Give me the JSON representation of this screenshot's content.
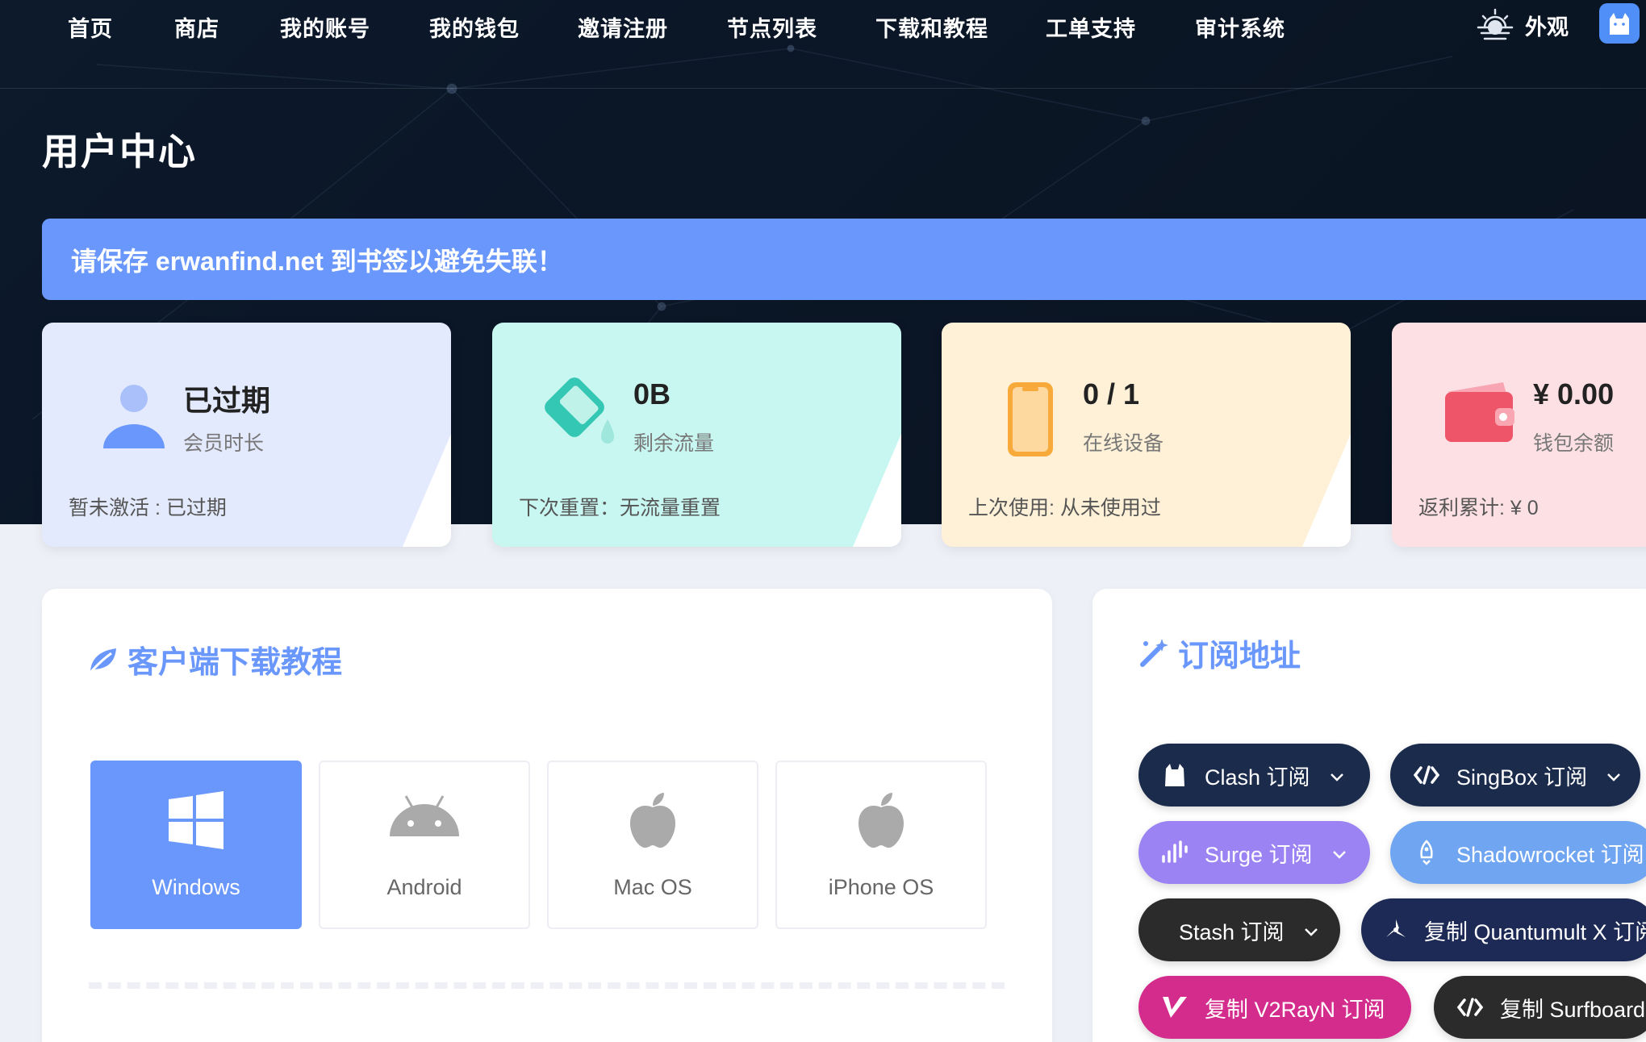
{
  "nav": {
    "items": [
      "首页",
      "商店",
      "我的账号",
      "我的钱包",
      "邀请注册",
      "节点列表",
      "下载和教程",
      "工单支持",
      "审计系统"
    ],
    "appearance_label": "外观"
  },
  "page_title": "用户中心",
  "alert_text": "请保存 erwanfind.net 到书签以避免失联！",
  "stats": [
    {
      "value": "已过期",
      "label": "会员时长",
      "foot": "暂未激活 : 已过期",
      "bg": "#e4eafd",
      "icon": "user-icon"
    },
    {
      "value": "0B",
      "label": "剩余流量",
      "foot": "下次重置：无流量重置",
      "bg": "#c8f6f0",
      "icon": "water-bucket-icon"
    },
    {
      "value": "0 / 1",
      "label": "在线设备",
      "foot": "上次使用: 从未使用过",
      "bg": "#fef1d7",
      "icon": "phone-icon"
    },
    {
      "value": "¥ 0.00",
      "label": "钱包余额",
      "foot": "返利累计: ¥ 0",
      "bg": "#fde0e4",
      "icon": "wallet-icon"
    }
  ],
  "download_panel": {
    "title": "客户端下载教程",
    "os": [
      "Windows",
      "Android",
      "Mac OS",
      "iPhone OS"
    ]
  },
  "subscribe_panel": {
    "title": "订阅地址",
    "buttons": [
      {
        "label": "Clash 订阅",
        "color": "#1b2b4b"
      },
      {
        "label": "SingBox 订阅",
        "color": "#1b2b4b"
      },
      {
        "label": "Surge 订阅",
        "color": "#9b83f3"
      },
      {
        "label": "Shadowrocket 订阅",
        "color": "#6fa5f1"
      },
      {
        "label": "Stash 订阅",
        "color": "#2b2b2b"
      },
      {
        "label": "复制 Quantumult X 订阅",
        "color": "#1d2a55"
      },
      {
        "label": "复制 V2RayN 订阅",
        "color": "#d42c8c"
      },
      {
        "label": "复制 Surfboard",
        "color": "#2b2b2b"
      }
    ]
  }
}
